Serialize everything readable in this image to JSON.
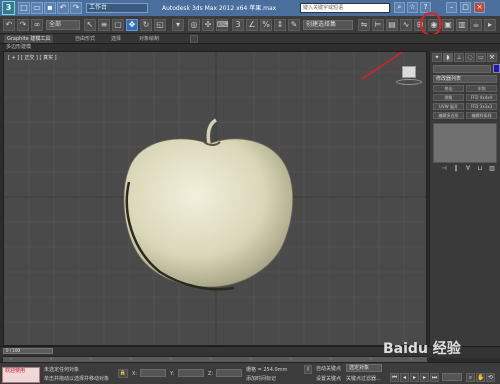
{
  "titlebar": {
    "title": "Autodesk 3ds Max 2012 x64",
    "subtitle": "苹果.max",
    "workspace": "工作台",
    "search_placeholder": "键入关键字或短语"
  },
  "toolbar": {
    "selection_filter": "全部",
    "named_selection": "创建选择集"
  },
  "ribbon": {
    "tabs": [
      "Graphite 建模工具",
      "自由形式",
      "选择",
      "对象绘制"
    ],
    "active_tab": "Graphite 建模工具",
    "sub_label": "多边形建模"
  },
  "viewport": {
    "label": "[ + ] [ 正交 ] [ 真实 ]",
    "object": "apple"
  },
  "command_panel": {
    "modifier_list": "修改器列表",
    "buttons": [
      "挤出",
      "车削",
      "倒角",
      "FFD 4x4x4",
      "UVW 展开",
      "FFD 3x3x3",
      "编辑多边形",
      "编辑样条线"
    ]
  },
  "timeline": {
    "frame": "0 / 100",
    "ticks": [
      "0",
      "10",
      "20",
      "30",
      "40",
      "50",
      "60",
      "70",
      "80",
      "90",
      "100"
    ]
  },
  "statusbar": {
    "maxscript": "欢迎使用",
    "status_line1": "未选定任何对象",
    "status_line2": "单击并拖动以选择并移动对象",
    "x_label": "X:",
    "y_label": "Y:",
    "z_label": "Z:",
    "grid": "栅格 = 254.0mm",
    "auto_key": "自动关键点",
    "set_key": "设置关键点",
    "selected": "选定对象",
    "key_filters": "关键点过滤器...",
    "add_time_tag": "添加时间标记"
  },
  "watermark": "Baidu 经验",
  "colors": {
    "title_bar": "#4a6f9c",
    "highlight": "#e0201a",
    "viewport_bg": "#4a4a4a",
    "apple": "#d9d6b8"
  }
}
